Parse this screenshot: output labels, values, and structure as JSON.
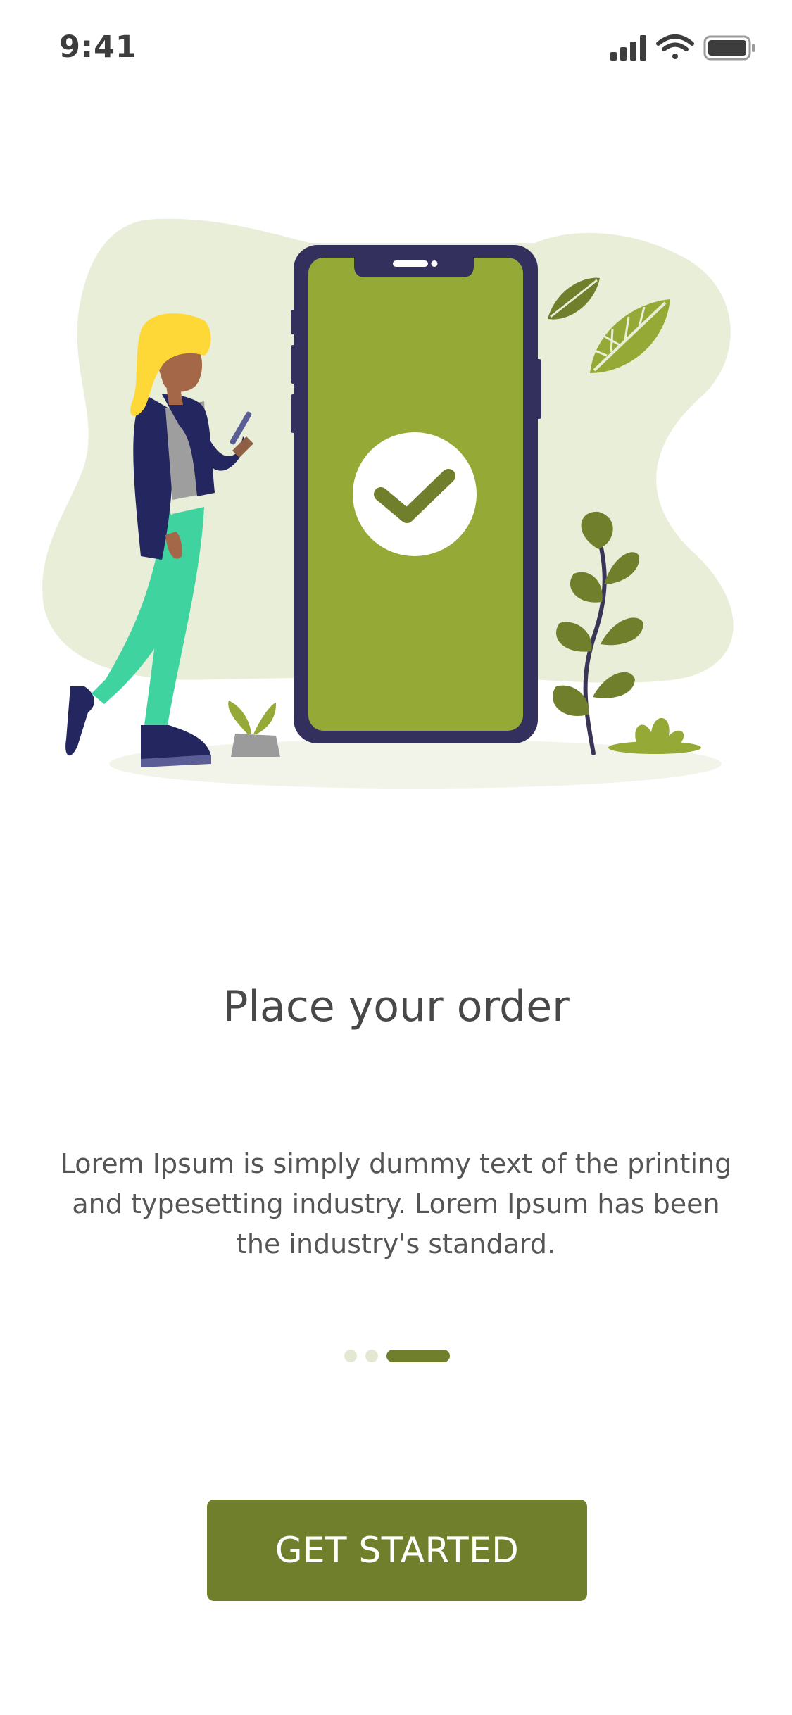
{
  "status_bar": {
    "time": "9:41",
    "icons": [
      "cellular-signal-icon",
      "wifi-icon",
      "battery-icon"
    ]
  },
  "illustration": {
    "name": "onboarding-illustration"
  },
  "onboarding": {
    "title": "Place your order",
    "description": "Lorem Ipsum is simply dummy text of the printing and typesetting industry. Lorem Ipsum has been the industry's standard.",
    "page_count": 3,
    "active_page_index": 2,
    "cta_label": "GET STARTED"
  },
  "colors": {
    "accent": "#6f7f2b",
    "screen_green": "#95aa36",
    "phone_frame": "#34305e",
    "backdrop": "#e9eed8",
    "dot_inactive": "#e3e8d2",
    "jacket": "#24275f",
    "pants": "#3fd3a0",
    "hair": "#fdd836"
  }
}
